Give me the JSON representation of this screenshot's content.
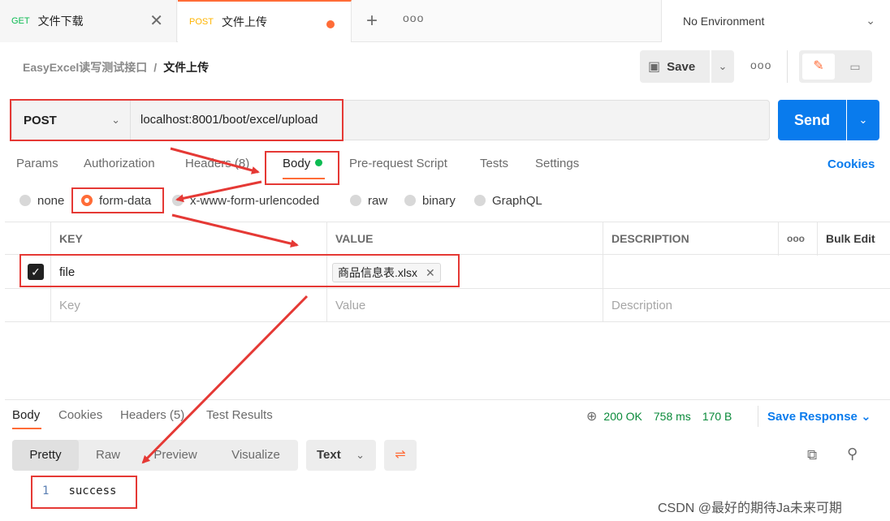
{
  "tabs": [
    {
      "method": "GET",
      "name": "文件下载",
      "close": "✕"
    },
    {
      "method": "POST",
      "name": "文件上传"
    }
  ],
  "tabbar": {
    "plus": "+",
    "more": "ooo"
  },
  "environment": {
    "label": "No Environment"
  },
  "breadcrumb": {
    "collection": "EasyExcel读写测试接口",
    "separator": "/",
    "request": "文件上传"
  },
  "toolbar": {
    "save_label": "Save",
    "more": "ooo"
  },
  "request": {
    "method": "POST",
    "url": "localhost:8001/boot/excel/upload",
    "send_label": "Send"
  },
  "request_tabs": [
    "Params",
    "Authorization",
    "Headers (8)",
    "Body",
    "Pre-request Script",
    "Tests",
    "Settings"
  ],
  "cookies_link": "Cookies",
  "body_types": [
    "none",
    "form-data",
    "x-www-form-urlencoded",
    "raw",
    "binary",
    "GraphQL"
  ],
  "params_table": {
    "headers": [
      "KEY",
      "VALUE",
      "DESCRIPTION",
      "ooo",
      "Bulk Edit"
    ],
    "rows": [
      {
        "key": "file",
        "value": "商品信息表.xlsx",
        "description": ""
      }
    ],
    "placeholders": {
      "key": "Key",
      "value": "Value",
      "description": "Description"
    }
  },
  "response_tabs": [
    "Body",
    "Cookies",
    "Headers (5)",
    "Test Results"
  ],
  "response_status": {
    "status": "200 OK",
    "time": "758 ms",
    "size": "170 B"
  },
  "save_response": "Save Response",
  "view_modes": [
    "Pretty",
    "Raw",
    "Preview",
    "Visualize"
  ],
  "format": "Text",
  "response_body": {
    "line_number": "1",
    "content": "success"
  },
  "watermark": "CSDN @最好的期待Ja未来可期",
  "colors": {
    "accent": "#ff6c37",
    "primary": "#097bed",
    "success": "#0cbb52",
    "annotation": "#e53935"
  }
}
